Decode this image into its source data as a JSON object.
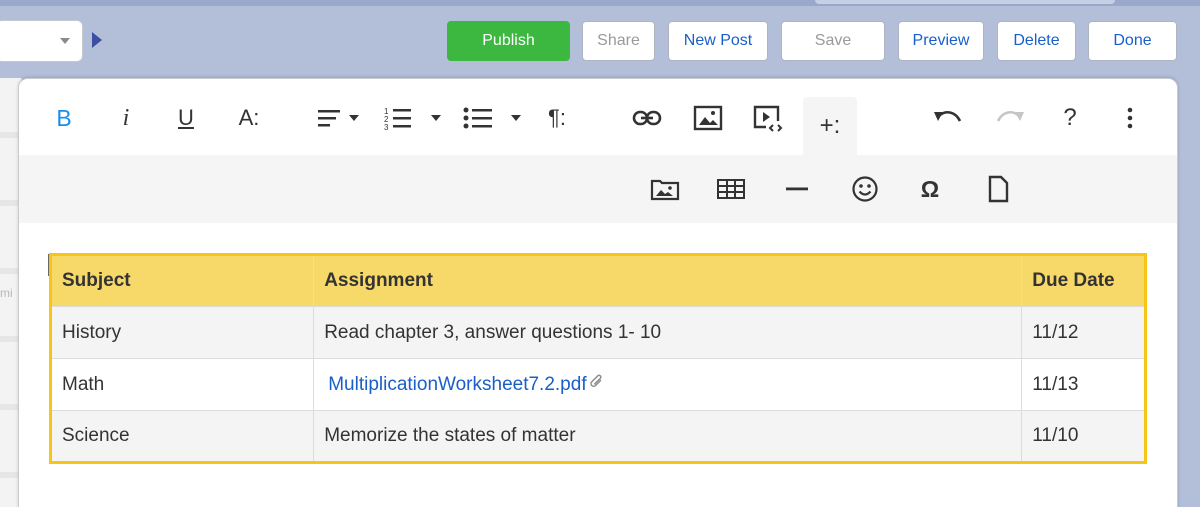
{
  "header": {
    "buttons": {
      "publish": "Publish",
      "share": "Share",
      "new_post": "New Post",
      "save": "Save",
      "preview": "Preview",
      "delete": "Delete",
      "done": "Done"
    }
  },
  "toolbar": {
    "primary": [
      "bold-icon",
      "italic-icon",
      "underline-icon",
      "font-size-icon",
      "align-icon",
      "ordered-list-icon",
      "unordered-list-icon",
      "paragraph-format-icon",
      "link-icon",
      "image-icon",
      "video-icon",
      "more-insert-icon",
      "undo-icon",
      "redo-icon",
      "help-icon",
      "more-options-icon"
    ],
    "bold_label": "B",
    "italic_label": "i",
    "underline_label": "U",
    "font_size_label": "A:",
    "paragraph_label": "¶:",
    "more_label": "+:",
    "help_label": "?",
    "secondary": [
      "insert-file-image-icon",
      "insert-table-icon",
      "horizontal-line-icon",
      "emoticon-icon",
      "special-character-icon",
      "insert-file-icon"
    ],
    "special_char_label": "Ω"
  },
  "sidebar": {
    "partial_text": "mi"
  },
  "table": {
    "headers": [
      "Subject",
      "Assignment",
      "Due Date"
    ],
    "rows": [
      [
        "History",
        "Read chapter 3, answer questions 1- 10",
        "11/12"
      ],
      [
        "Math",
        "MultiplicationWorksheet7.2.pdf",
        "11/13"
      ],
      [
        "Science",
        "Memorize the states of matter",
        "11/10"
      ]
    ]
  },
  "colors": {
    "accent_blue": "#1a5fc8",
    "publish_green": "#3cb841",
    "table_border": "#f5c518",
    "table_header_bg": "#f7d96a"
  }
}
